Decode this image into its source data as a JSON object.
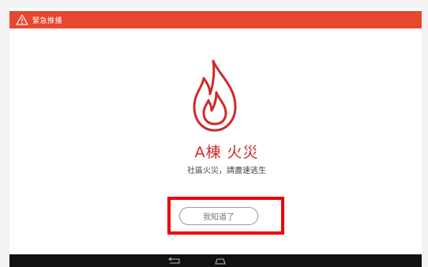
{
  "alert_bar": {
    "title": "緊急推播",
    "icon": "warning-triangle-icon",
    "color": "#e8472f"
  },
  "alert": {
    "icon": "fire-icon",
    "heading": "A棟 火災",
    "message": "社區火災，請盡速逃生",
    "heading_color": "#cf2a2a"
  },
  "acknowledge_button": {
    "label": "我知道了"
  },
  "highlight": {
    "color": "#ee0000"
  },
  "nav_bar": {
    "back_icon": "back-arrow-icon",
    "home_icon": "home-icon"
  }
}
